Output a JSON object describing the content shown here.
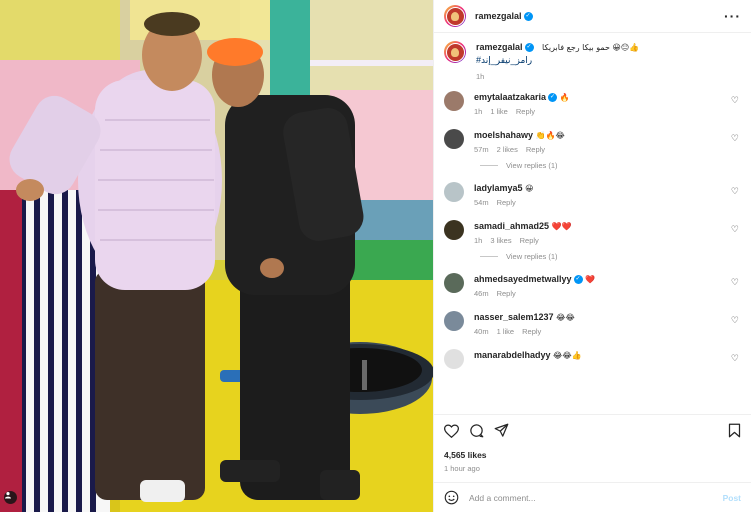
{
  "post": {
    "author": "ramezgalal",
    "caption": "حمو بيكا رجع فابريكا 😀😐👍",
    "hashtag": "#رامز_نيفر_إند",
    "caption_time": "1h",
    "likes": "4,565 likes",
    "posted": "1 hour ago"
  },
  "header": {
    "username": "ramezgalal",
    "more_icon": "more-horizontal-icon"
  },
  "comments": [
    {
      "username": "emytalaatzakaria",
      "verified": true,
      "text": "🔥",
      "time": "1h",
      "likes": "1 like",
      "reply": "Reply",
      "avatar_color": "#9b7a6a"
    },
    {
      "username": "moelshahawy",
      "verified": false,
      "text": "👏🔥😂",
      "time": "57m",
      "likes": "2 likes",
      "reply": "Reply",
      "view_replies": "View replies (1)",
      "avatar_color": "#4a4a4a"
    },
    {
      "username": "ladylamya5",
      "verified": false,
      "text": "😀",
      "time": "54m",
      "likes": "",
      "reply": "Reply",
      "avatar_color": "#b8c4c8"
    },
    {
      "username": "samadi_ahmad25",
      "verified": false,
      "text": "❤️❤️",
      "time": "1h",
      "likes": "3 likes",
      "reply": "Reply",
      "view_replies": "View replies (1)",
      "avatar_color": "#3b3320"
    },
    {
      "username": "ahmedsayedmetwallyy",
      "verified": true,
      "text": "❤️",
      "time": "46m",
      "likes": "",
      "reply": "Reply",
      "avatar_color": "#5a6a5a"
    },
    {
      "username": "nasser_salem1237",
      "verified": false,
      "text": "😂😂",
      "time": "40m",
      "likes": "1 like",
      "reply": "Reply",
      "avatar_color": "#7a8a9a"
    },
    {
      "username": "manarabdelhadyy",
      "verified": false,
      "text": "😂😂👍",
      "time": "",
      "likes": "",
      "reply": "",
      "avatar_color": "#e0e0e0"
    }
  ],
  "add_comment": {
    "placeholder": "Add a comment...",
    "post_label": "Post"
  },
  "colors": {
    "verified": "#0095f6",
    "meta": "#8e8e8e",
    "link": "#00376b",
    "post_button": "#b2dffc"
  }
}
